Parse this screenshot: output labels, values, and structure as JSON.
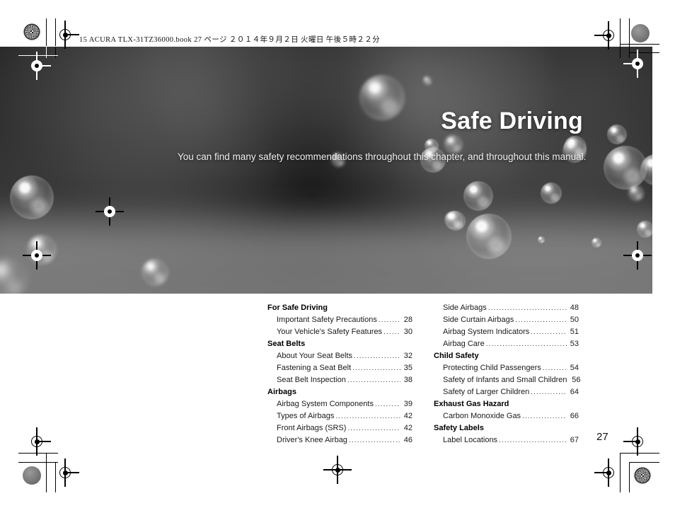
{
  "print_header": "15 ACURA TLX-31TZ36000.book   27 ページ   ２０１４年９月２日   火曜日   午後５時２２分",
  "hero": {
    "title": "Safe Driving",
    "subtitle": "You can find many safety recommendations throughout this chapter, and throughout this manual."
  },
  "page_number": "27",
  "colors": {
    "background": "#ffffff",
    "text": "#000000",
    "hero_text": "#ffffff",
    "hero_backdrop": "#101010"
  },
  "toc": {
    "left_column": [
      {
        "type": "heading",
        "label": "For Safe Driving"
      },
      {
        "type": "entry",
        "label": "Important Safety Precautions",
        "page": "28"
      },
      {
        "type": "entry",
        "label": "Your Vehicle's Safety Features",
        "page": "30"
      },
      {
        "type": "heading",
        "label": "Seat Belts"
      },
      {
        "type": "entry",
        "label": "About Your Seat Belts",
        "page": "32"
      },
      {
        "type": "entry",
        "label": "Fastening a Seat Belt",
        "page": "35"
      },
      {
        "type": "entry",
        "label": "Seat Belt Inspection",
        "page": "38"
      },
      {
        "type": "heading",
        "label": "Airbags"
      },
      {
        "type": "entry",
        "label": "Airbag System Components",
        "page": "39"
      },
      {
        "type": "entry",
        "label": "Types of Airbags",
        "page": "42"
      },
      {
        "type": "entry",
        "label": "Front Airbags (SRS)",
        "page": "42"
      },
      {
        "type": "entry",
        "label": "Driver's Knee Airbag",
        "page": "46"
      }
    ],
    "right_column": [
      {
        "type": "entry",
        "label": "Side Airbags",
        "page": "48"
      },
      {
        "type": "entry",
        "label": "Side Curtain Airbags",
        "page": "50"
      },
      {
        "type": "entry",
        "label": "Airbag System Indicators",
        "page": "51"
      },
      {
        "type": "entry",
        "label": "Airbag Care",
        "page": "53"
      },
      {
        "type": "heading",
        "label": "Child Safety"
      },
      {
        "type": "entry",
        "label": "Protecting Child Passengers",
        "page": "54"
      },
      {
        "type": "entry",
        "label": "Safety of Infants and Small Children",
        "page": "56"
      },
      {
        "type": "entry",
        "label": "Safety of Larger Children",
        "page": "64"
      },
      {
        "type": "heading",
        "label": "Exhaust Gas Hazard"
      },
      {
        "type": "entry",
        "label": "Carbon Monoxide Gas",
        "page": "66"
      },
      {
        "type": "heading",
        "label": "Safety Labels"
      },
      {
        "type": "entry",
        "label": "Label Locations",
        "page": "67"
      }
    ]
  },
  "print_marks": {
    "registration_target": "registration-crosshair",
    "color_star": "color-registration-star",
    "gray_patch": "gray-density-patch",
    "crop_lines": "trim-crop-lines"
  }
}
